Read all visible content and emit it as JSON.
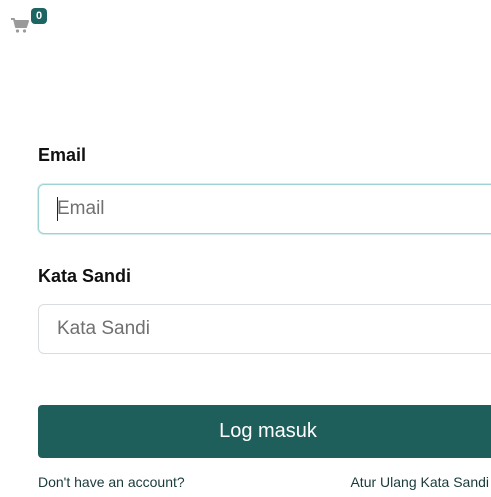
{
  "cart": {
    "icon": "shopping-cart-icon",
    "count": "0",
    "icon_color": "#9a9a9a",
    "badge_color": "#1d6563"
  },
  "form": {
    "email_label": "Email",
    "email_placeholder": "Email",
    "email_value": "",
    "password_label": "Kata Sandi",
    "password_placeholder": "Kata Sandi",
    "password_value": "",
    "submit_label": "Log masuk",
    "submit_color": "#1e5f5b"
  },
  "links": {
    "signup": "Don't have an account?",
    "reset_password": "Atur Ulang Kata Sandi"
  }
}
